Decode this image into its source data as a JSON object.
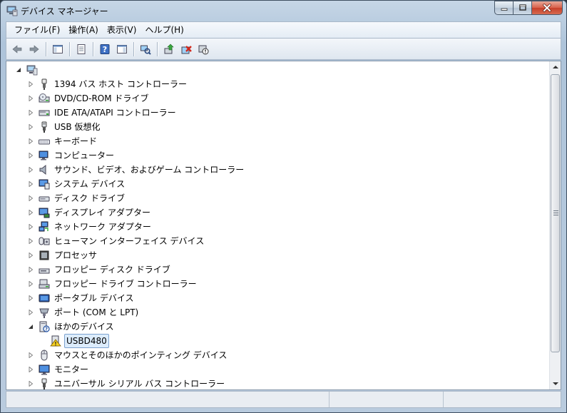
{
  "window": {
    "title": "デバイス マネージャー",
    "icon": "device-manager-icon",
    "accent_color": "#3399ff"
  },
  "caption_buttons": [
    {
      "name": "minimize-icon"
    },
    {
      "name": "maximize-icon"
    },
    {
      "name": "close-icon"
    }
  ],
  "menu": [
    {
      "label": "ファイル(F)"
    },
    {
      "label": "操作(A)"
    },
    {
      "label": "表示(V)"
    },
    {
      "label": "ヘルプ(H)"
    }
  ],
  "toolbar": [
    {
      "icon": "back-arrow-icon"
    },
    {
      "icon": "forward-arrow-icon"
    },
    {
      "separator": true
    },
    {
      "icon": "show-hide-console-tree-icon"
    },
    {
      "separator": true
    },
    {
      "icon": "properties-icon"
    },
    {
      "separator": true
    },
    {
      "icon": "help-icon"
    },
    {
      "icon": "show-action-pane-icon"
    },
    {
      "separator": true
    },
    {
      "icon": "scan-hardware-changes-icon"
    },
    {
      "separator": true
    },
    {
      "icon": "update-driver-icon"
    },
    {
      "icon": "uninstall-device-icon"
    },
    {
      "icon": "disable-device-icon"
    }
  ],
  "tree": {
    "root": {
      "label": "",
      "expanded": true,
      "icon": "computer-root-icon"
    },
    "items": [
      {
        "label": "1394 バス ホスト コントローラー",
        "icon": "bus-controller-icon",
        "expanded": false
      },
      {
        "label": "DVD/CD-ROM ドライブ",
        "icon": "dvd-drive-icon",
        "expanded": false
      },
      {
        "label": "IDE ATA/ATAPI コントローラー",
        "icon": "ide-controller-icon",
        "expanded": false
      },
      {
        "label": "USB 仮想化",
        "icon": "usb-icon",
        "expanded": false
      },
      {
        "label": "キーボード",
        "icon": "keyboard-icon",
        "expanded": false
      },
      {
        "label": "コンピューター",
        "icon": "computer-icon",
        "expanded": false
      },
      {
        "label": "サウンド、ビデオ、およびゲーム コントローラー",
        "icon": "speaker-icon",
        "expanded": false
      },
      {
        "label": "システム デバイス",
        "icon": "system-device-icon",
        "expanded": false
      },
      {
        "label": "ディスク ドライブ",
        "icon": "disk-drive-icon",
        "expanded": false
      },
      {
        "label": "ディスプレイ アダプター",
        "icon": "display-adapter-icon",
        "expanded": false
      },
      {
        "label": "ネットワーク アダプター",
        "icon": "network-adapter-icon",
        "expanded": false
      },
      {
        "label": "ヒューマン インターフェイス デバイス",
        "icon": "hid-icon",
        "expanded": false
      },
      {
        "label": "プロセッサ",
        "icon": "processor-icon",
        "expanded": false
      },
      {
        "label": "フロッピー ディスク ドライブ",
        "icon": "floppy-drive-icon",
        "expanded": false
      },
      {
        "label": "フロッピー ドライブ コントローラー",
        "icon": "floppy-controller-icon",
        "expanded": false
      },
      {
        "label": "ポータブル デバイス",
        "icon": "portable-device-icon",
        "expanded": false
      },
      {
        "label": "ポート (COM と LPT)",
        "icon": "port-icon",
        "expanded": false
      },
      {
        "label": "ほかのデバイス",
        "icon": "other-devices-icon",
        "expanded": true,
        "children": [
          {
            "label": "USBD480",
            "icon": "unknown-device-warning-icon",
            "selected": true
          }
        ]
      },
      {
        "label": "マウスとそのほかのポインティング デバイス",
        "icon": "mouse-icon",
        "expanded": false
      },
      {
        "label": "モニター",
        "icon": "monitor-icon",
        "expanded": false
      },
      {
        "label": "ユニバーサル シリアル バス コントローラー",
        "icon": "usb-controller-icon",
        "expanded": false
      }
    ]
  },
  "scrollbar": {
    "position": 0.0
  },
  "statusbar": {
    "panes": [
      "",
      "",
      ""
    ]
  }
}
